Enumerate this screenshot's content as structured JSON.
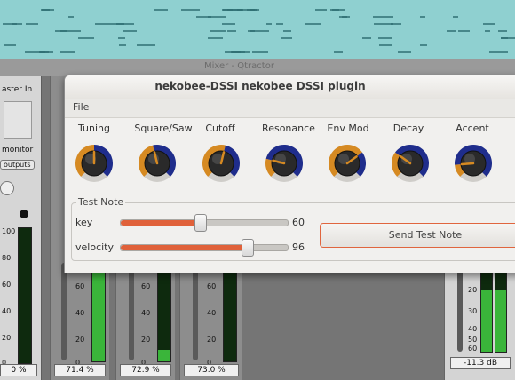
{
  "window": {
    "title": "nekobee-DSSI nekobee DSSI plugin",
    "menu": [
      "File"
    ]
  },
  "knobs": [
    {
      "label": "Tuning",
      "level": 0.5
    },
    {
      "label": "Square/Saw",
      "level": 0.45
    },
    {
      "label": "Cutoff",
      "level": 0.55
    },
    {
      "label": "Resonance",
      "level": 0.22
    },
    {
      "label": "Env Mod",
      "level": 0.7
    },
    {
      "label": "Decay",
      "level": 0.3
    },
    {
      "label": "Accent",
      "level": 0.15
    }
  ],
  "test_note": {
    "title": "Test Note",
    "key_label": "key",
    "key_value": "60",
    "key_max": 127,
    "velocity_label": "velocity",
    "velocity_value": "96",
    "velocity_max": 127,
    "send_label": "Send Test Note"
  },
  "mixer": {
    "title": "Mixer - Qtractor",
    "master_label": "aster In",
    "monitor_label": "monitor",
    "outputs_label": "outputs",
    "scale": [
      "100",
      "80",
      "60",
      "40",
      "20",
      "0"
    ],
    "strip_values": [
      "0 %",
      "71.4 %",
      "72.9 %",
      "73.0 %",
      "-11.3 dB"
    ],
    "right_scale": [
      "20",
      "30",
      "40",
      "50",
      "60"
    ]
  },
  "colors": {
    "accent": "#e0613a",
    "knob_ring_blue": "#1f2d8c",
    "knob_ring_orange": "#d68a22",
    "track_bg": "#8fd0d0"
  }
}
